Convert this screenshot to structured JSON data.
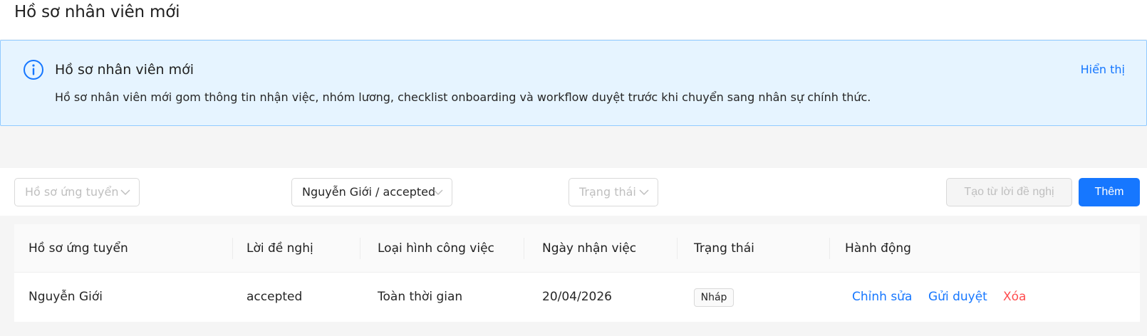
{
  "page": {
    "title": "Hồ sơ nhân viên mới"
  },
  "alert": {
    "title": "Hồ sơ nhân viên mới",
    "description": "Hồ sơ nhân viên mới gom thông tin nhận việc, nhóm lương, checklist onboarding và workflow duyệt trước khi chuyển sang nhân sự chính thức.",
    "action": "Hiển thị",
    "icon": "info-icon"
  },
  "filters": {
    "candidate": {
      "placeholder": "Hồ sơ ứng tuyển"
    },
    "offer": {
      "value": "Nguyễn Giới / accepted"
    },
    "status": {
      "placeholder": "Trạng thái"
    }
  },
  "actions": {
    "create_from_offer": "Tạo từ lời đề nghị",
    "add": "Thêm"
  },
  "table": {
    "columns": [
      "Hồ sơ ứng tuyển",
      "Lời đề nghị",
      "Loại hình công việc",
      "Ngày nhận việc",
      "Trạng thái",
      "Hành động"
    ],
    "rows": [
      {
        "candidate": "Nguyễn Giới",
        "offer": "accepted",
        "job_type": "Toàn thời gian",
        "start_date": "20/04/2026",
        "status": "Nháp",
        "actions": {
          "edit": "Chỉnh sửa",
          "submit": "Gửi duyệt",
          "delete": "Xóa"
        }
      }
    ]
  },
  "colors": {
    "primary": "#1677ff",
    "danger": "#ff4d4f",
    "alert_bg": "#e6f4ff",
    "alert_border": "#91caff"
  }
}
